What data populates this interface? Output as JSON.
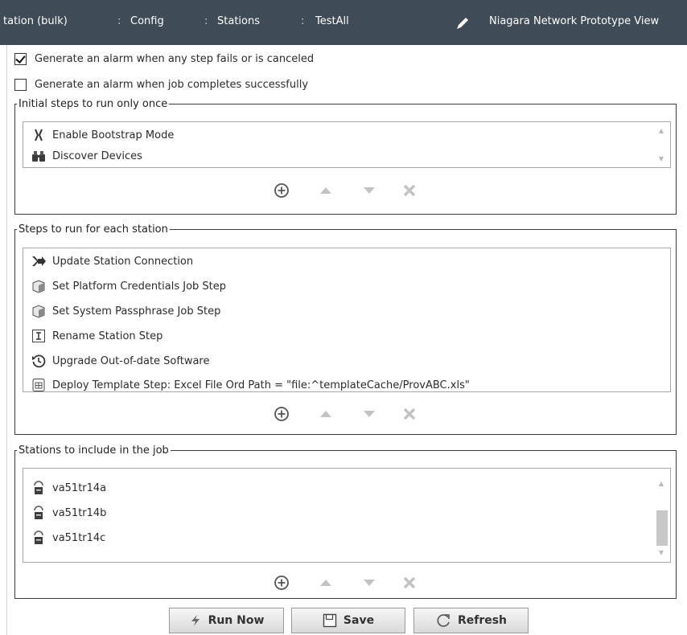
{
  "header": {
    "breadcrumbs": [
      "tation (bulk)",
      "Config",
      "Stations",
      "TestAll"
    ],
    "separator": ":",
    "view_title": "Niagara Network Prototype View",
    "pencil_icon": "pencil-icon"
  },
  "options": [
    {
      "label": "Generate an alarm when any step fails or is canceled",
      "checked": true
    },
    {
      "label": "Generate an alarm when job completes successfully",
      "checked": false
    }
  ],
  "initial_steps": {
    "legend": "Initial steps to run only once",
    "items": [
      {
        "label": "Enable Bootstrap Mode",
        "icon": "bootstrap-tool-icon"
      },
      {
        "label": "Discover Devices",
        "icon": "binoculars-icon"
      }
    ]
  },
  "station_steps": {
    "legend": "Steps to run for each station",
    "items": [
      {
        "label": "Update Station Connection",
        "icon": "connection-arrow-icon"
      },
      {
        "label": "Set Platform Credentials Job Step",
        "icon": "cube-icon"
      },
      {
        "label": "Set System Passphrase Job Step",
        "icon": "cube-icon"
      },
      {
        "label": "Rename Station Step",
        "icon": "text-cursor-icon"
      },
      {
        "label": "Upgrade Out-of-date Software",
        "icon": "history-icon"
      },
      {
        "label": "Deploy Template Step: Excel File Ord Path = \"file:^templateCache/ProvABC.xls\"",
        "icon": "template-icon"
      }
    ]
  },
  "stations": {
    "legend": "Stations to include in the job",
    "items": [
      {
        "label": "va51tr14a",
        "icon": "station-icon"
      },
      {
        "label": "va51tr14b",
        "icon": "station-icon"
      },
      {
        "label": "va51tr14c",
        "icon": "station-icon"
      }
    ]
  },
  "list_controls": [
    "add-icon",
    "move-up-icon",
    "move-down-icon",
    "remove-icon"
  ],
  "buttons": {
    "run_now": "Run Now",
    "save": "Save",
    "refresh": "Refresh"
  },
  "colors": {
    "header_bg": "#3f4b56",
    "control_gray": "#6f6f6f",
    "control_light": "#c3c3c3"
  }
}
